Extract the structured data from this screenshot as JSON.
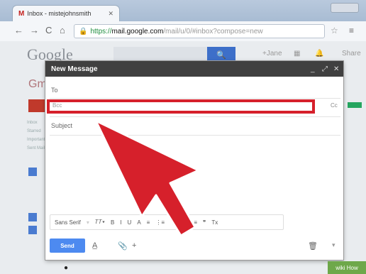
{
  "browser": {
    "tab_title": "Inbox - mistejohnsmith",
    "tab_icon": "gmail-icon",
    "url_scheme": "https://",
    "url_host": "mail.google.com",
    "url_path": "/mail/u/0/#inbox?compose=new"
  },
  "gmail": {
    "logo_text": "Google",
    "side_label": "Gmail",
    "search_icon": "search-icon",
    "topright_items": [
      "+Jane",
      "▦",
      "🔔",
      "Share"
    ]
  },
  "compose": {
    "title": "New Message",
    "to_label": "To",
    "bcc_label": "Bcc",
    "cc_label": "Cc",
    "subject_label": "Subject",
    "send_label": "Send",
    "formatting": {
      "font": "Sans Serif",
      "items": [
        "B",
        "I",
        "U",
        "A",
        "≡",
        "⋮≡",
        "⋮≡",
        "≡",
        "≡",
        "❞",
        "Tx"
      ]
    },
    "highlight_color": "#d6202b"
  },
  "watermark": "wiki How"
}
